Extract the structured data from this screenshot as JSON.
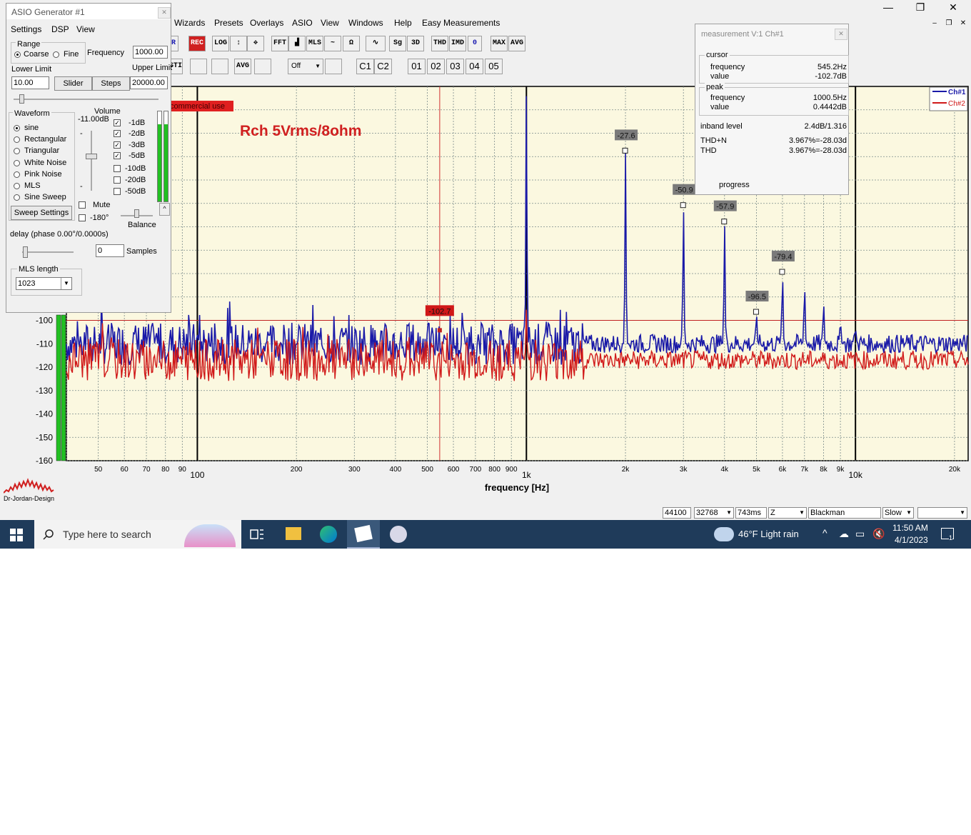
{
  "app": {
    "menu": [
      "Wizards",
      "Presets",
      "Overlays",
      "ASIO",
      "View",
      "Windows",
      "Help",
      "Easy Measurements"
    ],
    "window_controls": [
      "—",
      "❐",
      "✕"
    ],
    "inner_controls": [
      "–",
      "❐",
      "✕"
    ]
  },
  "toolbar": {
    "row1": [
      "R",
      "REC",
      "LOG",
      "↕",
      "✥",
      "FFT",
      "▟",
      "MLS",
      "~",
      "Ω",
      "∿",
      "Sg",
      "3D",
      "THD",
      "IMD",
      "0",
      "MAX",
      "AVG"
    ],
    "row2": [
      "STI",
      "",
      "",
      "AVG",
      ""
    ],
    "dropdown": "Off",
    "channels": [
      "C1",
      "C2"
    ],
    "slots": [
      "01",
      "02",
      "03",
      "04",
      "05"
    ]
  },
  "generator": {
    "title": "ASIO Generator #1",
    "menu": [
      "Settings",
      "DSP",
      "View"
    ],
    "range_label": "Range",
    "coarse": "Coarse",
    "fine": "Fine",
    "frequency_label": "Frequency",
    "frequency_value": "1000.00",
    "lower_limit_label": "Lower Limit",
    "lower_limit_value": "10.00",
    "slider_btn": "Slider",
    "steps_btn": "Steps",
    "upper_limit_label": "Upper Limit",
    "upper_limit_value": "20000.00",
    "waveform_label": "Waveform",
    "waveforms": [
      "sine",
      "Rectangular",
      "Triangular",
      "White Noise",
      "Pink Noise",
      "MLS",
      "Sine Sweep"
    ],
    "sweep_settings": "Sweep Settings",
    "volume_label": "Volume",
    "volume_value": "-11.00dB",
    "vol_minus": "-",
    "vol_minus2": "-",
    "attenuators": [
      {
        "label": "-1dB",
        "checked": true
      },
      {
        "label": "-2dB",
        "checked": true
      },
      {
        "label": "-3dB",
        "checked": true
      },
      {
        "label": "-5dB",
        "checked": true
      },
      {
        "label": "-10dB",
        "checked": false
      },
      {
        "label": "-20dB",
        "checked": false
      },
      {
        "label": "-50dB",
        "checked": false
      }
    ],
    "mute": "Mute",
    "invert": "-180°",
    "balance": "Balance",
    "delay_label": "delay (phase  0.00°/0.0000s)",
    "samples_value": "0",
    "samples_label": "Samples",
    "mls_length_label": "MLS length",
    "mls_length_value": "1023"
  },
  "measurement": {
    "title": "measurement V:1 Ch#1",
    "cursor_label": "cursor",
    "cursor_freq_label": "frequency",
    "cursor_freq_value": "545.2Hz",
    "cursor_val_label": "value",
    "cursor_val_value": "-102.7dB",
    "peak_label": "peak",
    "peak_freq_label": "frequency",
    "peak_freq_value": "1000.5Hz",
    "peak_val_label": "value",
    "peak_val_value": "0.4442dB",
    "inband_label": "inband level",
    "inband_value": "2.4dB/1.316",
    "thdn_label": "THD+N",
    "thdn_value": "3.967%=-28.03d",
    "thd_label": "THD",
    "thd_value": "3.967%=-28.03d",
    "progress_label": "progress"
  },
  "plot": {
    "watermark": "commercial use",
    "annotation": "Rch 5Vrms/8ohm",
    "logo": "Dr-Jordan-Design"
  },
  "chart_data": {
    "type": "line",
    "xlabel": "frequency [Hz]",
    "ylabel": "",
    "x_scale": "log",
    "xlim": [
      40,
      22000
    ],
    "ylim": [
      -160,
      0
    ],
    "x_ticks": [
      {
        "v": 50,
        "l": "50"
      },
      {
        "v": 60,
        "l": "60"
      },
      {
        "v": 70,
        "l": "70"
      },
      {
        "v": 80,
        "l": "80"
      },
      {
        "v": 90,
        "l": "90"
      },
      {
        "v": 100,
        "l": "100"
      },
      {
        "v": 200,
        "l": "200"
      },
      {
        "v": 300,
        "l": "300"
      },
      {
        "v": 400,
        "l": "400"
      },
      {
        "v": 500,
        "l": "500"
      },
      {
        "v": 600,
        "l": "600"
      },
      {
        "v": 700,
        "l": "700"
      },
      {
        "v": 800,
        "l": "800"
      },
      {
        "v": 900,
        "l": "900"
      },
      {
        "v": 1000,
        "l": "1k"
      },
      {
        "v": 2000,
        "l": "2k"
      },
      {
        "v": 3000,
        "l": "3k"
      },
      {
        "v": 4000,
        "l": "4k"
      },
      {
        "v": 5000,
        "l": "5k"
      },
      {
        "v": 6000,
        "l": "6k"
      },
      {
        "v": 7000,
        "l": "7k"
      },
      {
        "v": 8000,
        "l": "8k"
      },
      {
        "v": 9000,
        "l": "9k"
      },
      {
        "v": 10000,
        "l": "10k"
      },
      {
        "v": 20000,
        "l": "20k"
      }
    ],
    "y_ticks": [
      -100,
      -110,
      -120,
      -130,
      -140,
      -150,
      -160
    ],
    "legend": [
      "Ch#1",
      "Ch#2"
    ],
    "legend_position": "top-right",
    "series": [
      {
        "name": "Ch#1",
        "color": "#1a1aa8",
        "noise_floor": -110,
        "peaks": [
          [
            1000,
            -2
          ],
          [
            2000,
            -27.6
          ],
          [
            3000,
            -50.9
          ],
          [
            4000,
            -57.9
          ],
          [
            5000,
            -96.5
          ],
          [
            6000,
            -79.4
          ],
          [
            7000,
            -84
          ],
          [
            8000,
            -92
          ],
          [
            9000,
            -100
          ],
          [
            10000,
            -103
          ]
        ]
      },
      {
        "name": "Ch#2",
        "color": "#d01818",
        "noise_floor": -117,
        "peaks": [
          [
            1000,
            -95
          ]
        ]
      }
    ],
    "peak_labels": [
      {
        "x": 2000,
        "y": -27.6,
        "text": "-27.6"
      },
      {
        "x": 3000,
        "y": -50.9,
        "text": "-50.9"
      },
      {
        "x": 4000,
        "y": -57.9,
        "text": "-57.9"
      },
      {
        "x": 5000,
        "y": -96.5,
        "text": "-96.5"
      },
      {
        "x": 6000,
        "y": -79.4,
        "text": "-79.4"
      }
    ],
    "cursor": {
      "x": 545.2,
      "y": -102.7,
      "text": "-102.7"
    },
    "reference_level": -100
  },
  "statusbar": {
    "fields": [
      "44100",
      "32768",
      "743ms",
      "Z",
      "Blackman",
      "Slow",
      ""
    ]
  },
  "taskbar": {
    "search": "Type here to search",
    "weather": "46°F  Light rain",
    "time": "11:50 AM",
    "date": "4/1/2023",
    "notif": "1"
  }
}
